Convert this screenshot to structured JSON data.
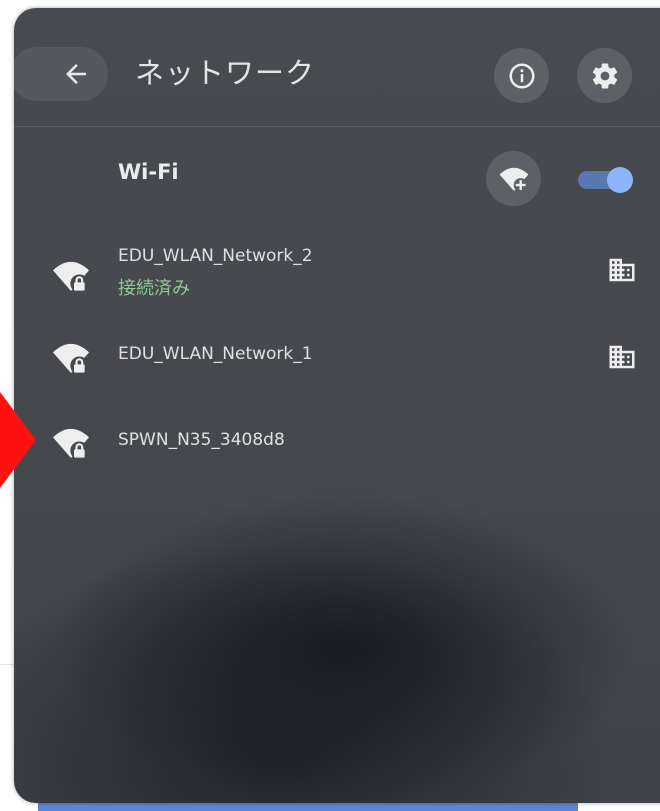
{
  "header": {
    "title": "ネットワーク"
  },
  "wifi": {
    "section_title": "Wi-Fi",
    "enabled": true
  },
  "networks": [
    {
      "name": "EDU_WLAN_Network_2",
      "status": "接続済み",
      "secured": true,
      "managed": true
    },
    {
      "name": "EDU_WLAN_Network_1",
      "status": "",
      "secured": true,
      "managed": true
    },
    {
      "name": "SPWN_N35_3408d8",
      "status": "",
      "secured": true,
      "managed": false
    }
  ],
  "icons": {
    "back": "arrow-left-icon",
    "info": "info-icon",
    "settings": "gear-icon",
    "add_wifi": "wifi-add-icon",
    "network": "wifi-lock-icon",
    "enterprise": "building-icon",
    "marker": "red-arrow-marker"
  },
  "colors": {
    "panel_background": "#45484d",
    "connected_text": "#8ecb94",
    "toggle_track": "#5878b0",
    "toggle_knob": "#8cb4f8",
    "marker": "#ff1111",
    "bottom_strip": "#5a86d6"
  }
}
